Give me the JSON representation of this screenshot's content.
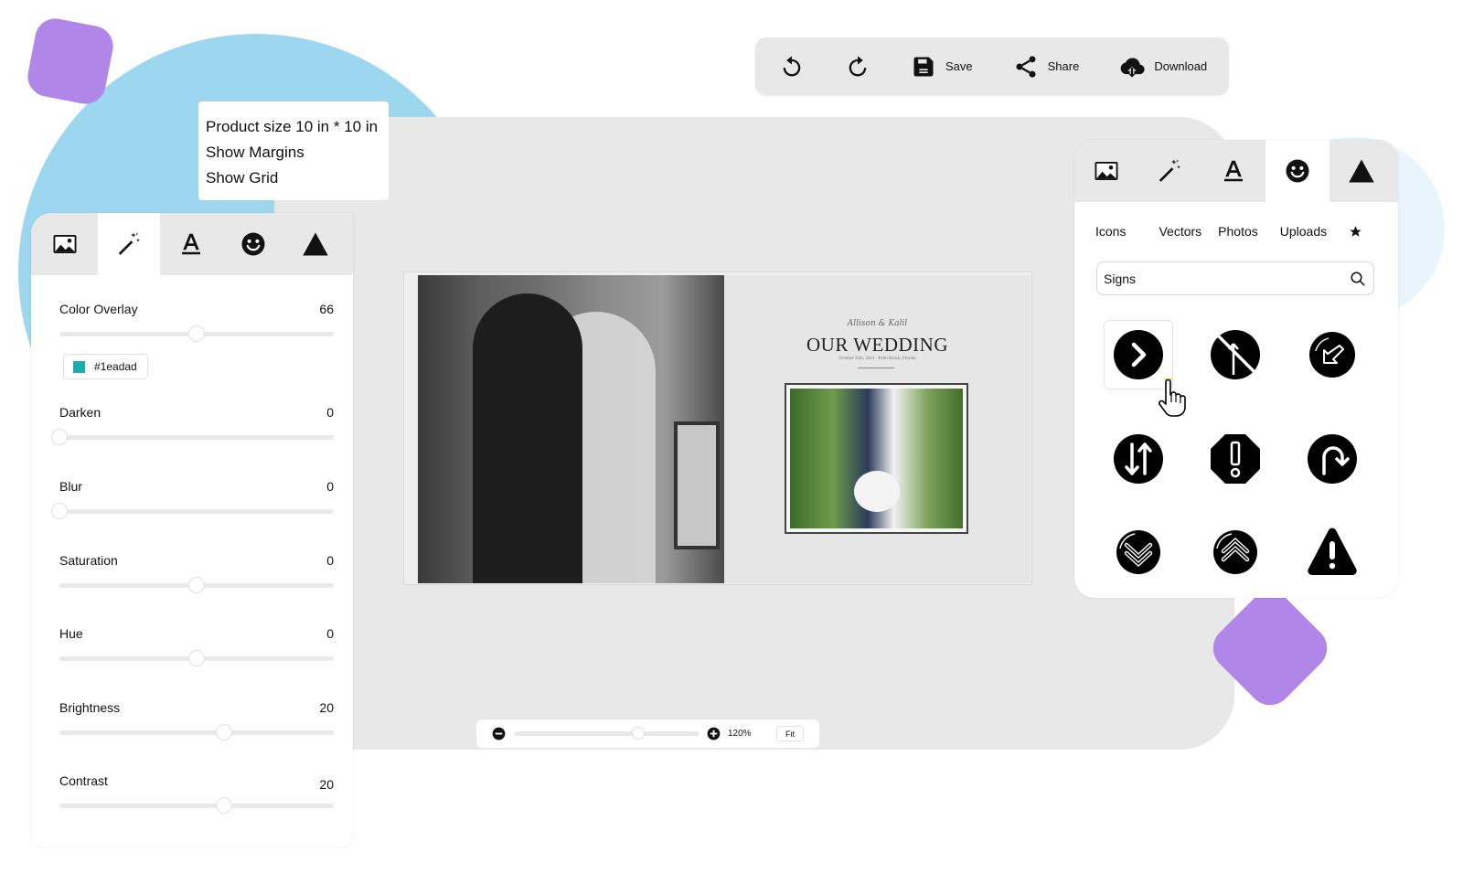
{
  "toolbar": {
    "undo_icon": "undo-icon",
    "redo_icon": "redo-icon",
    "save_label": "Save",
    "share_label": "Share",
    "download_label": "Download"
  },
  "product_menu": {
    "product_size": "Product size  10 in * 10 in",
    "show_margins": "Show Margins",
    "show_grid": "Show Grid"
  },
  "left_panel": {
    "tabs": [
      {
        "name": "image-icon",
        "active": false
      },
      {
        "name": "magic-wand-icon",
        "active": true
      },
      {
        "name": "text-icon",
        "active": false
      },
      {
        "name": "smiley-icon",
        "active": false
      },
      {
        "name": "shape-triangle-icon",
        "active": false
      }
    ],
    "adjustments": [
      {
        "label": "Color Overlay",
        "value": "66",
        "position": 0.5
      },
      {
        "label": "Darken",
        "value": "0",
        "position": 0.0
      },
      {
        "label": "Blur",
        "value": "0",
        "position": 0.0
      },
      {
        "label": "Saturation",
        "value": "0",
        "position": 0.5
      },
      {
        "label": "Hue",
        "value": "0",
        "position": 0.5
      },
      {
        "label": "Brightness",
        "value": "20",
        "position": 0.6
      },
      {
        "label": "Contrast",
        "value": "20",
        "position": 0.6
      }
    ],
    "overlay_color": {
      "hex_label": "#1eadad",
      "color": "#1eadad"
    }
  },
  "book": {
    "names": "Allison & Kalil",
    "title": "OUR WEDDING",
    "date": "October 25th, 2014 · Palm Beach, Florida"
  },
  "zoom": {
    "value": "120%",
    "fit_label": "Fit",
    "position": 0.67
  },
  "right_panel": {
    "tabs": [
      {
        "name": "image-icon",
        "active": false
      },
      {
        "name": "magic-wand-icon",
        "active": false
      },
      {
        "name": "text-icon",
        "active": false
      },
      {
        "name": "smiley-icon",
        "active": true
      },
      {
        "name": "shape-triangle-icon",
        "active": false
      }
    ],
    "subtabs": [
      "Icons",
      "Vectors",
      "Photos",
      "Uploads"
    ],
    "favorites_icon": "star-icon",
    "search": {
      "value": "Signs",
      "placeholder": "Search"
    },
    "icons": [
      {
        "name": "chevron-right-circle-icon",
        "selected": true
      },
      {
        "name": "no-straight-ahead-icon",
        "selected": false
      },
      {
        "name": "arrow-down-left-circle-icon",
        "selected": false
      },
      {
        "name": "two-way-arrows-circle-icon",
        "selected": false
      },
      {
        "name": "exclamation-octagon-icon",
        "selected": false
      },
      {
        "name": "u-turn-right-circle-icon",
        "selected": false
      },
      {
        "name": "double-chevron-down-circle-icon",
        "selected": false
      },
      {
        "name": "double-chevron-up-circle-icon",
        "selected": false
      },
      {
        "name": "warning-triangle-icon",
        "selected": false
      }
    ]
  },
  "colors": {
    "accent_purple": "#b087e9",
    "accent_blue": "#9dd6ef",
    "canvas_gray": "#e8e8e8"
  }
}
